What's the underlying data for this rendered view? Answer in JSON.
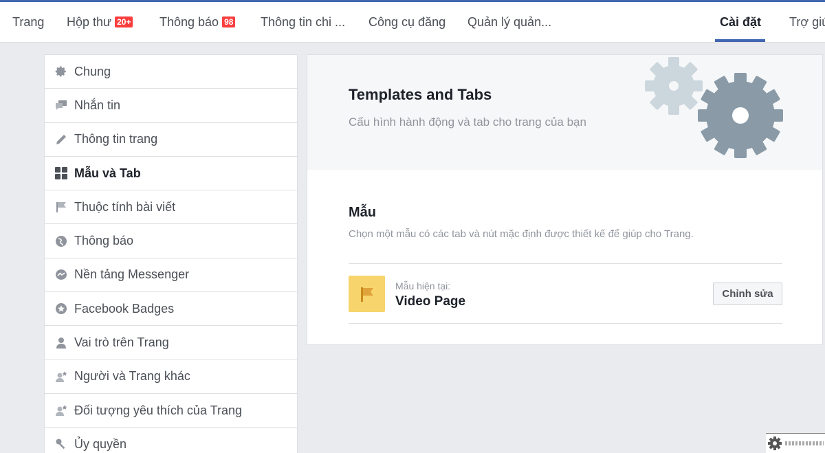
{
  "topnav": {
    "tabs": [
      {
        "label": "Trang"
      },
      {
        "label": "Hộp thư",
        "badge": "20+"
      },
      {
        "label": "Thông báo",
        "badge": "98"
      },
      {
        "label": "Thông tin chi ..."
      },
      {
        "label": "Công cụ đăng"
      },
      {
        "label": "Quản lý quản..."
      },
      {
        "label": "Cài đặt",
        "active": true
      },
      {
        "label": "Trợ giú"
      }
    ]
  },
  "sidebar": {
    "items": [
      {
        "label": "Chung",
        "icon": "gear-icon"
      },
      {
        "label": "Nhắn tin",
        "icon": "chat-bubbles-icon"
      },
      {
        "label": "Thông tin trang",
        "icon": "pencil-icon"
      },
      {
        "label": "Mẫu và Tab",
        "icon": "grid-icon",
        "active": true
      },
      {
        "label": "Thuộc tính bài viết",
        "icon": "flag-icon"
      },
      {
        "label": "Thông báo",
        "icon": "globe-icon"
      },
      {
        "label": "Nền tảng Messenger",
        "icon": "messenger-icon"
      },
      {
        "label": "Facebook Badges",
        "icon": "star-badge-icon"
      },
      {
        "label": "Vai trò trên Trang",
        "icon": "person-icon"
      },
      {
        "label": "Người và Trang khác",
        "icon": "person-star-icon"
      },
      {
        "label": "Đối tượng yêu thích của Trang",
        "icon": "person-star-icon"
      },
      {
        "label": "Ủy quyền",
        "icon": "key-icon"
      }
    ]
  },
  "main": {
    "hero_title": "Templates and Tabs",
    "hero_subtitle": "Cấu hình hành động và tab cho trang của bạn",
    "section_title": "Mẫu",
    "section_desc": "Chọn một mẫu có các tab và nút mặc định được thiết kế để giúp cho Trang.",
    "current_label": "Mẫu hiện tại:",
    "current_template": "Video Page",
    "edit_button": "Chỉnh sửa"
  },
  "colors": {
    "accent": "#4267b2",
    "badge": "#fa3e3e",
    "template_icon_bg": "#f7d46c",
    "gear_dark": "#8a9ba7",
    "gear_light": "#ccd6dd"
  }
}
